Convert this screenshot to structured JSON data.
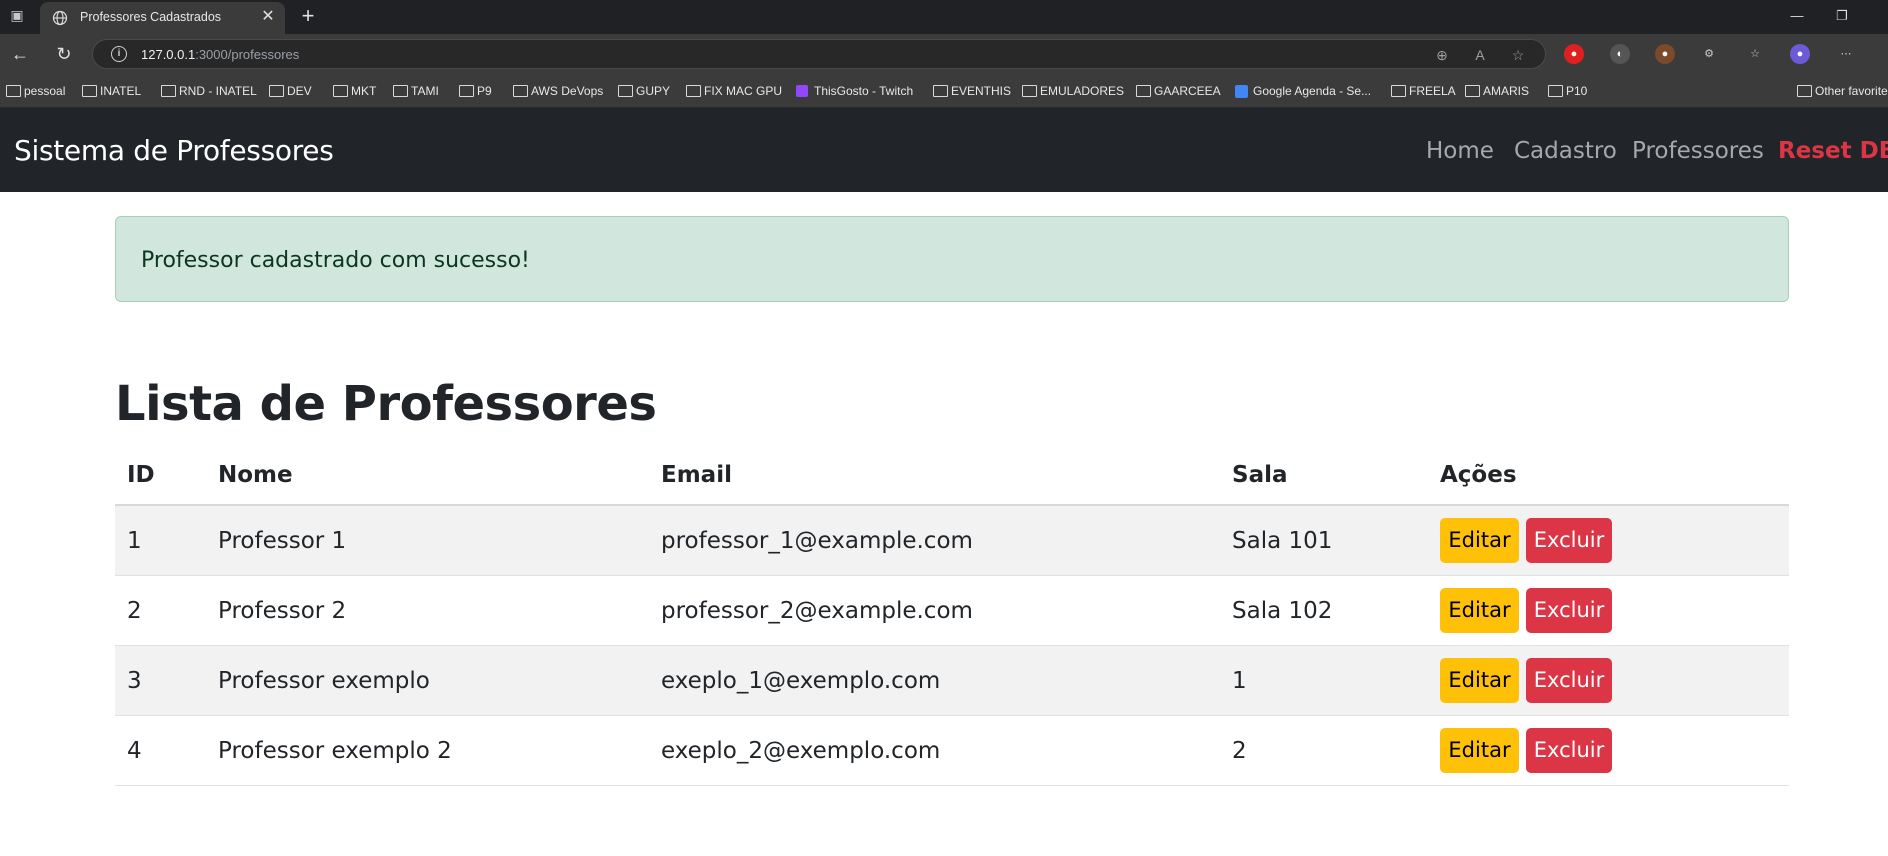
{
  "browser": {
    "tab_title": "Professores Cadastrados",
    "url_host": "127.0.0.1",
    "url_rest": ":3000/professores",
    "bookmarks": [
      "pessoal",
      "INATEL",
      "RND - INATEL",
      "DEV",
      "MKT",
      "TAMI",
      "P9",
      "AWS DeVops",
      "GUPY",
      "FIX MAC GPU",
      "ThisGosto - Twitch",
      "EVENTHIS",
      "EMULADORES",
      "GAARCEEA",
      "Google Agenda - Se...",
      "FREELA",
      "AMARIS",
      "P10",
      "Other favorites"
    ]
  },
  "site": {
    "brand": "Sistema de Professores",
    "nav": [
      "Home",
      "Cadastro",
      "Professores",
      "Reset DB"
    ]
  },
  "alert": {
    "message": "Professor cadastrado com sucesso!"
  },
  "main": {
    "title": "Lista de Professores",
    "columns": [
      "ID",
      "Nome",
      "Email",
      "Sala",
      "Ações"
    ],
    "rows": [
      {
        "id": "1",
        "nome": "Professor 1",
        "email": "professor_1@example.com",
        "sala": "Sala 101"
      },
      {
        "id": "2",
        "nome": "Professor 2",
        "email": "professor_2@example.com",
        "sala": "Sala 102"
      },
      {
        "id": "3",
        "nome": "Professor exemplo",
        "email": "exeplo_1@exemplo.com",
        "sala": "1"
      },
      {
        "id": "4",
        "nome": "Professor exemplo 2",
        "email": "exeplo_2@exemplo.com",
        "sala": "2"
      }
    ],
    "edit_label": "Editar",
    "delete_label": "Excluir"
  },
  "colors": {
    "nav_bg": "#212529",
    "alert_bg": "#d1e7dd",
    "warning": "#ffc107",
    "danger": "#dc3545"
  }
}
